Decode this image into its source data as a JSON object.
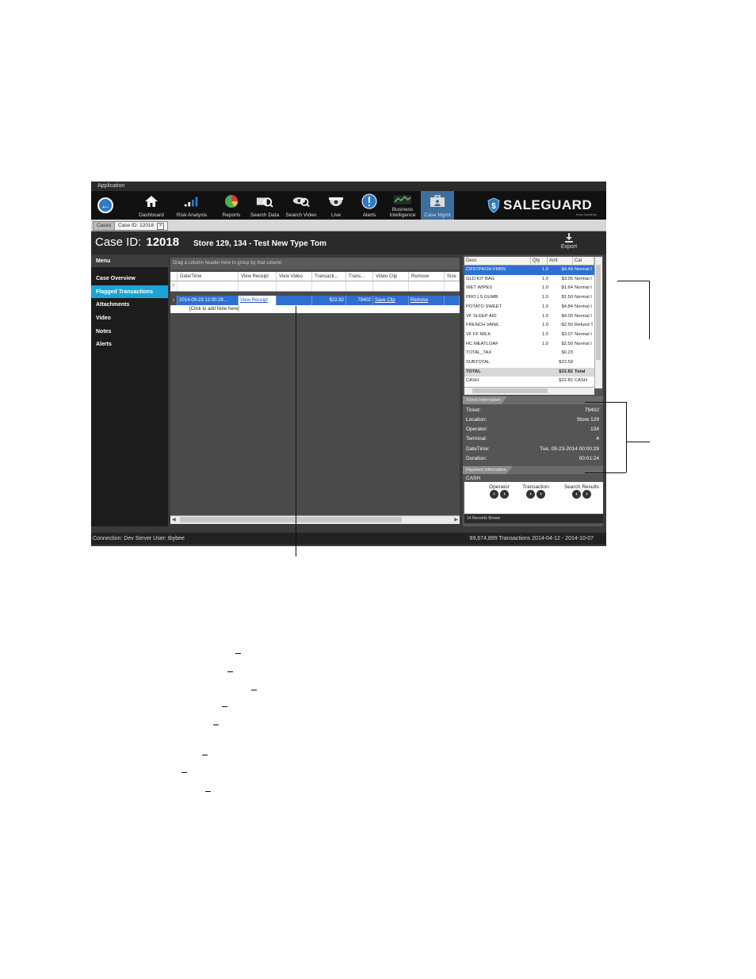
{
  "app_label": "Application",
  "ribbon": {
    "items": [
      {
        "label": "Dashboard",
        "icon": "home-icon"
      },
      {
        "label": "Risk Analysis",
        "icon": "bar-chart-icon"
      },
      {
        "label": "Reports",
        "icon": "pie-chart-icon"
      },
      {
        "label": "Search Data",
        "icon": "search-data-icon"
      },
      {
        "label": "Search Video",
        "icon": "search-video-icon"
      },
      {
        "label": "Live",
        "icon": "camera-dome-icon"
      },
      {
        "label": "Alerts",
        "icon": "alert-icon"
      },
      {
        "label": "Business Intelligence",
        "icon": "line-chart-icon"
      },
      {
        "label": "Case Mgmt",
        "icon": "case-icon"
      }
    ],
    "logo": {
      "name": "SALEGUARD",
      "sub": "from OpenEye"
    }
  },
  "tabs": {
    "cases": "Cases",
    "case_tab": "Case ID: 12018"
  },
  "header": {
    "case_label": "Case ID:",
    "case_number": "12018",
    "description": "Store 129, 134 - Test New Type Tom",
    "export": "Export"
  },
  "menu": {
    "title": "Menu",
    "items": [
      "Case Overview",
      "Flagged Transactions",
      "Attachments",
      "Video",
      "Notes",
      "Alerts"
    ]
  },
  "grid": {
    "group_hint": "Drag a column header here to group by that column",
    "columns": [
      "Date/Time",
      "View Receipt",
      "View Video",
      "Transacti...",
      "Trans...",
      "Video Clip",
      "Remove",
      "Size"
    ],
    "row": {
      "datetime": "2014-09-23 12:00:29...",
      "view_receipt": "View Receipt",
      "transaction_amt": "$22.82",
      "trans_num": "79402",
      "video_clip": "Save Clip",
      "remove": "Remove"
    },
    "note_row": "[Click to add Note here]"
  },
  "receipt": {
    "columns": [
      "Desc",
      "Qty",
      "Amt",
      "Cat"
    ],
    "rows": [
      [
        "CRSTPROH FRBN",
        "1.0",
        "$4.49",
        "Normal I"
      ],
      [
        "GLD KIT BAG",
        "1.0",
        "$3.05",
        "Normal I"
      ],
      [
        "WET WIPES",
        "1.0",
        "$1.64",
        "Normal I"
      ],
      [
        "PRO LS GUMB",
        "1.0",
        "$1.50",
        "Normal I"
      ],
      [
        "POTATO SWEET",
        "1.0",
        "$4.84",
        "Normal I"
      ],
      [
        "VF SLEEP AID",
        "1.0",
        "$4.00",
        "Normal I"
      ],
      [
        "FRENCH VANIL",
        "1.0",
        "-$2.50",
        "Refund T"
      ],
      [
        "VF FF MILK",
        "1.0",
        "$3.07",
        "Normal I"
      ],
      [
        "HC MEATLOAF",
        "1.0",
        "$2.50",
        "Normal I"
      ],
      [
        "TOTAL_TAX",
        "",
        "$0.23",
        ""
      ],
      [
        "SUBTOTAL",
        "",
        "$22.59",
        ""
      ],
      [
        "TOTAL",
        "",
        "$22.82",
        "Total"
      ],
      [
        "CASH",
        "",
        "$22.82",
        "CASH"
      ]
    ]
  },
  "ticket_info": {
    "title": "Ticket Information",
    "fields": [
      {
        "k": "Ticket:",
        "v": "79402"
      },
      {
        "k": "Location:",
        "v": "Store 129"
      },
      {
        "k": "Operator:",
        "v": "134"
      },
      {
        "k": "Terminal:",
        "v": "4"
      },
      {
        "k": "DateTime:",
        "v": "Tue, 09-23-2014    00:00:29"
      },
      {
        "k": "Duration:",
        "v": "00:01:24"
      }
    ]
  },
  "payment_info": {
    "title": "Payment Information",
    "value": "CASH"
  },
  "nav": {
    "operator": "Operator",
    "transaction": "Transaction",
    "search_results": "Search Results"
  },
  "records_shown": "14 Records Shown",
  "status": {
    "left": "Connection: Dev Server  User: tbybee",
    "right": "99,674,899 Transactions 2014-04-12 - 2014-10-07"
  },
  "colors": {
    "accent": "#17a6d6",
    "selection": "#2f6fcf",
    "ribbon_active": "#3c6e9e"
  }
}
